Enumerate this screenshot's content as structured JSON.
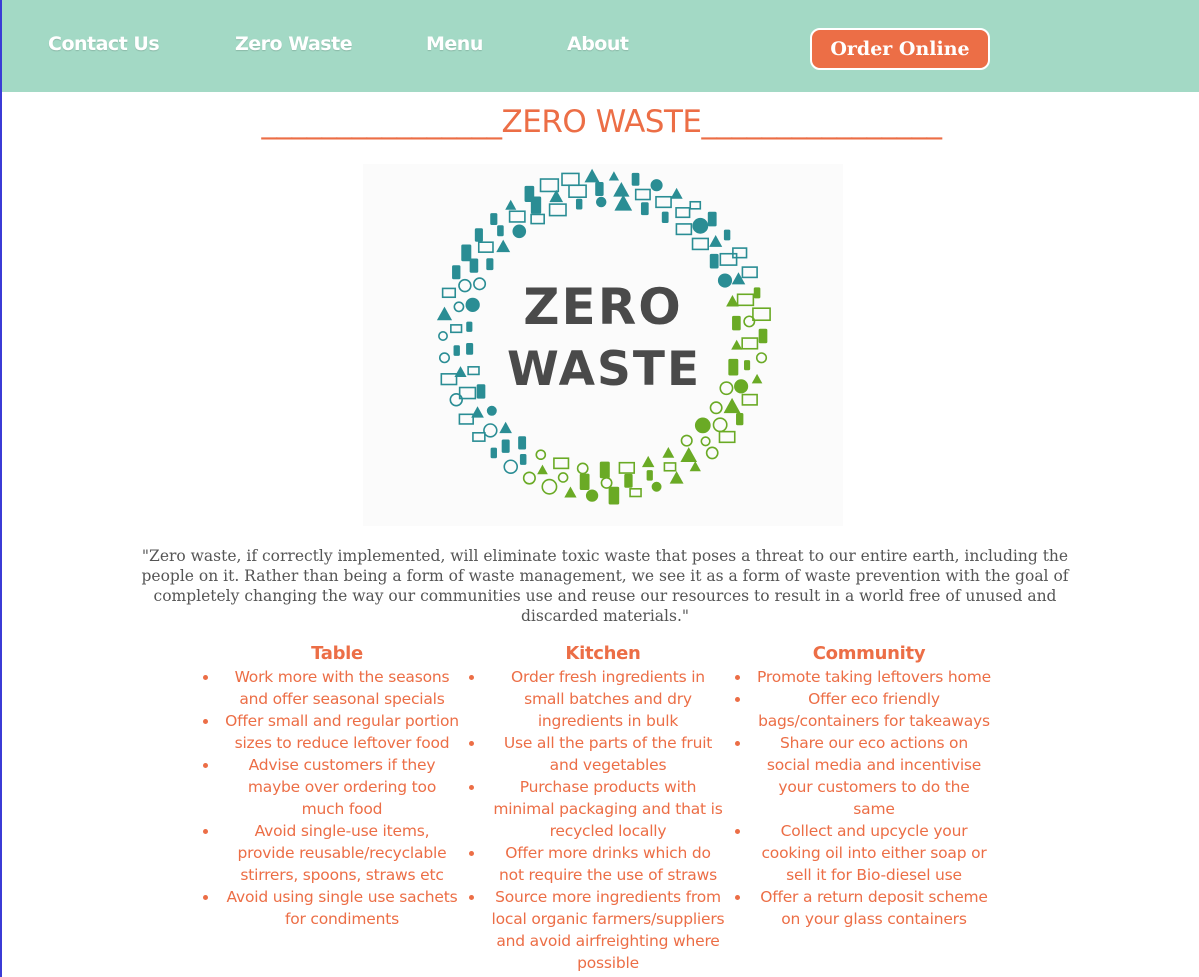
{
  "nav": {
    "links": [
      "Contact Us",
      "Zero Waste",
      "Menu",
      "About"
    ],
    "order_button": "Order Online"
  },
  "page_title": "________________ZERO WASTE________________",
  "logo": {
    "line1": "ZERO",
    "line2": "WASTE"
  },
  "colors": {
    "nav_bg": "#a3d9c5",
    "accent": "#ec6e46",
    "teal": "#2a8d94",
    "green": "#6aaa25"
  },
  "quote": "\"Zero waste, if correctly implemented, will eliminate toxic waste that poses a threat to our entire earth, including the people on it. Rather than being a form of waste management, we see it as a form of waste prevention with the goal of completely changing the way our communities use and reuse our resources to result in a world free of unused and discarded materials.\"",
  "columns": [
    {
      "heading": "Table",
      "items": [
        "Work more with the seasons and offer seasonal specials",
        "Offer small and regular portion sizes to reduce leftover food",
        "Advise customers if they maybe over ordering too much food",
        "Avoid single-use items, provide reusable/recyclable stirrers, spoons, straws etc",
        "Avoid using single use sachets for condiments"
      ]
    },
    {
      "heading": "Kitchen",
      "items": [
        "Order fresh ingredients in small batches and dry ingredients in bulk",
        "Use all the parts of the fruit and vegetables",
        "Purchase products with minimal packaging and that is recycled locally",
        "Offer more drinks which do not require the use of straws",
        "Source more ingredients from local organic farmers/suppliers and avoid airfreighting where possible"
      ]
    },
    {
      "heading": "Community",
      "items": [
        "Promote taking leftovers home",
        "Offer eco friendly bags/containers for takeaways",
        "Share our eco actions on social media and incentivise your customers to do the same",
        "Collect and upcycle your cooking oil into either soap or sell it for Bio-diesel use",
        "Offer a return deposit scheme on your glass containers"
      ]
    }
  ]
}
